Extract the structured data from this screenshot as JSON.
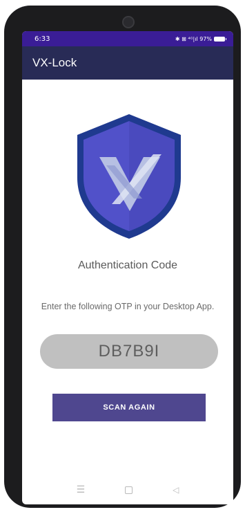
{
  "status_bar": {
    "time": "6:33",
    "icons": "✱ ⊠ ⁴ᴳ|ıl 97%",
    "battery_icon": "battery-icon"
  },
  "app_bar": {
    "title": "VX-Lock"
  },
  "logo": {
    "icon": "vx-shield-logo",
    "colors": {
      "outer": "#1f3a8f",
      "inner": "#5151c9",
      "mark": "#b7c0e3"
    }
  },
  "content": {
    "title": "Authentication Code",
    "instructions": "Enter the following OTP in your Desktop App.",
    "otp": "DB7B9I",
    "scan_button": "SCAN AGAIN"
  },
  "nav_bar": {
    "menu_icon": "menu-icon",
    "home_icon": "home-icon",
    "back_icon": "back-icon"
  },
  "colors": {
    "status_bar": "#3a1d96",
    "app_bar": "#282b56",
    "button": "#4f478f",
    "otp_background": "#c0c0c0"
  }
}
